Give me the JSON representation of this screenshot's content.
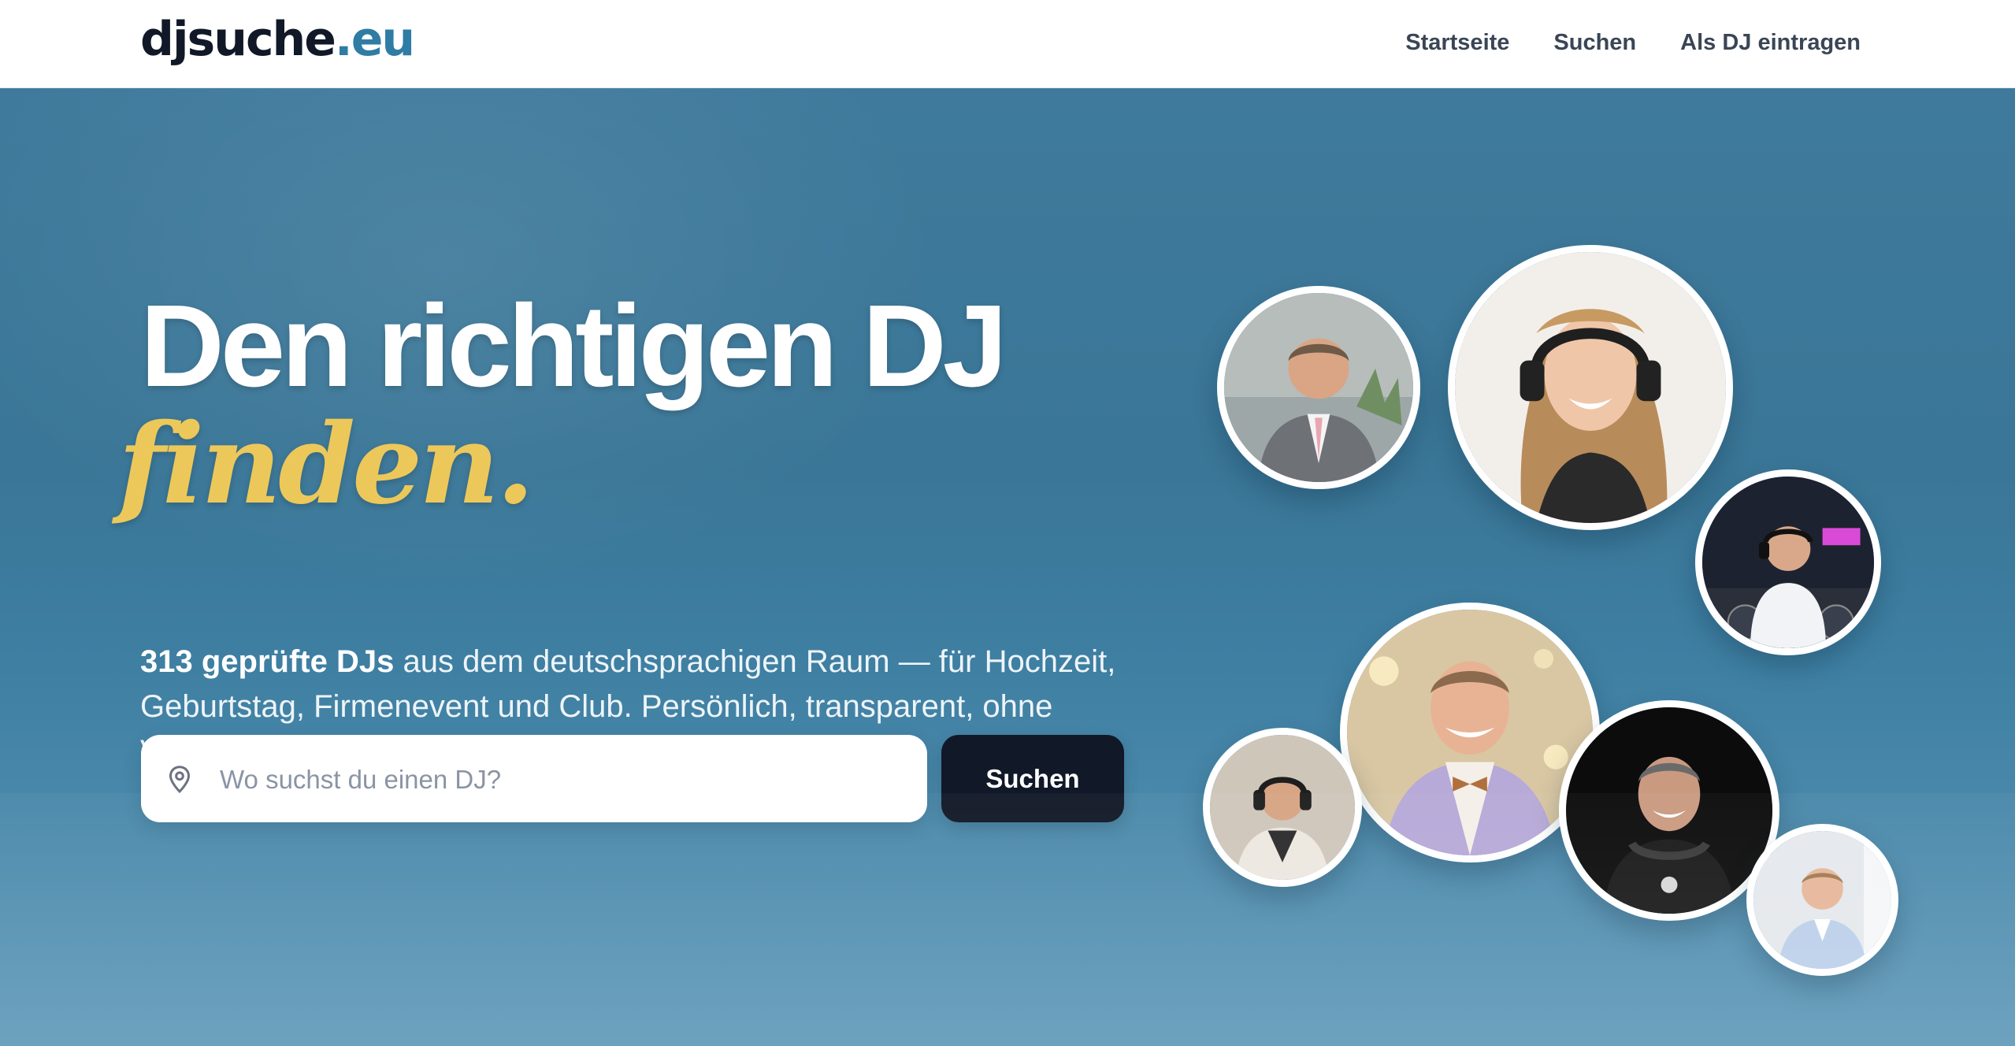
{
  "header": {
    "logo_main": "djsuche",
    "logo_tld": ".eu",
    "nav": [
      "Startseite",
      "Suchen",
      "Als DJ eintragen"
    ]
  },
  "hero": {
    "headline": "Den richtigen DJ",
    "headline_accent": "finden.",
    "lead_bold": "313 geprüfte DJs",
    "lead_rest": " aus dem deutschsprachigen Raum — für Hochzeit, Geburtstag, Firmenevent und Club. Persönlich, transparent, ohne Vermittlungsgebühr.",
    "search_placeholder": "Wo suchst du einen DJ?",
    "search_button": "Suchen"
  },
  "colors": {
    "brand_dark": "#111827",
    "brand_accent": "#2f7ca4",
    "headline_accent": "#ecc85a"
  },
  "icons": {
    "search_field_icon": "map-pin-icon"
  }
}
